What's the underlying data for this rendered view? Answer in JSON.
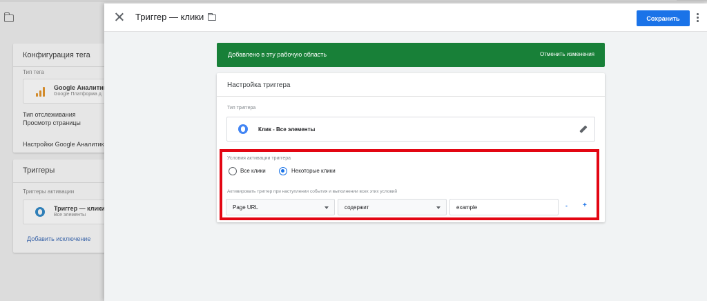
{
  "background": {
    "tag_config_card": {
      "title": "Конфигурация тега",
      "tag_type_label": "Тип тега",
      "tag_name": "Google Аналитика",
      "tag_sub": "Google Платформа д",
      "tracking_type_label": "Тип отслеживания",
      "tracking_type_value": "Просмотр страницы",
      "settings_label": "Настройки Google Аналитик"
    },
    "triggers_card": {
      "title": "Триггеры",
      "firing_label": "Триггеры активации",
      "trigger_name": "Триггер — клики",
      "trigger_sub": "Все элементы",
      "add_exception": "Добавить исключение"
    }
  },
  "panel": {
    "title": "Триггер — клики",
    "save_label": "Сохранить"
  },
  "banner": {
    "text": "Добавлено в эту рабочую область",
    "action": "Отменить изменения",
    "color": "#188038"
  },
  "config": {
    "title": "Настройка триггера",
    "type_label": "Тип триггера",
    "type_value": "Клик - Все элементы",
    "conditions_label": "Условия активации триггера",
    "radio_all": "Все клики",
    "radio_some": "Некоторые клики",
    "selected_radio": "radio_some",
    "fire_label": "Активировать триггер при наступлении события и выполнении всех этих условий",
    "condition": {
      "variable": "Page URL",
      "operator": "содержит",
      "value": "example"
    },
    "minus": "-",
    "plus": "+"
  },
  "colors": {
    "accent": "#1a73e8",
    "highlight": "#e30613"
  }
}
